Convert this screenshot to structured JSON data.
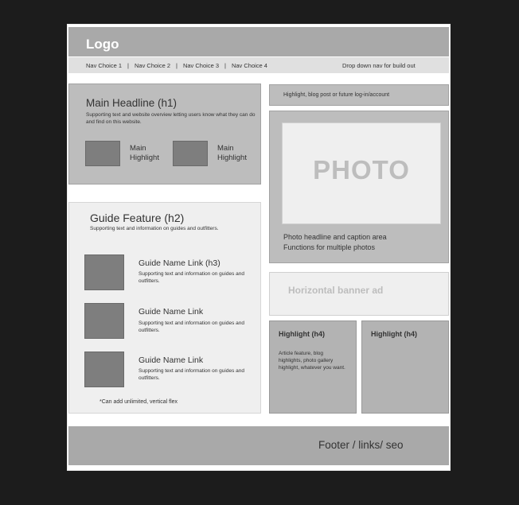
{
  "header": {
    "logo": "Logo"
  },
  "nav": {
    "items": [
      "Nav Choice 1",
      "Nav Choice 2",
      "Nav Choice 3",
      "Nav Choice 4"
    ],
    "separator": "|",
    "dropdown_note": "Drop down nav for build out"
  },
  "main": {
    "headline": "Main Headline (h1)",
    "supporting": "Supporting text and website overview letting users know what they can do and find on this website.",
    "highlights": [
      "Main Highlight",
      "Main Highlight"
    ]
  },
  "guide": {
    "title": "Guide Feature (h2)",
    "supporting": "Supporting text and information on guides and outfitters.",
    "items": [
      {
        "title": "Guide Name Link (h3)",
        "desc": "Supporting text and information on guides and outfitters."
      },
      {
        "title": "Guide Name Link",
        "desc": "Supporting text and information on guides and outfitters."
      },
      {
        "title": "Guide Name Link",
        "desc": "Supporting text and information on guides and outfitters."
      }
    ],
    "note": "*Can add unlimited, vertical flex"
  },
  "side": {
    "top_text": "Highlight, blog post or future log-in/account",
    "photo_label": "PHOTO",
    "photo_caption": [
      "Photo headline and caption area",
      "Functions for multiple photos"
    ],
    "banner": "Horizontal banner ad",
    "highlight_a": {
      "title": "Highlight (h4)",
      "desc": "Article feature, blog highlights, photo gallery highlight, whatever you want."
    },
    "highlight_b": {
      "title": "Highlight (h4)"
    }
  },
  "footer": {
    "text": "Footer / links/ seo"
  }
}
